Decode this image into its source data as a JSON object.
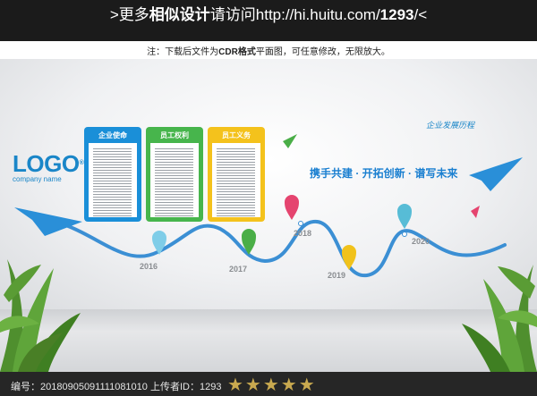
{
  "banner": {
    "prefix": ">更多",
    "highlight": "相似设计",
    "middle": "请访问http://hi.huitu.com/",
    "code": "1293",
    "suffix": "/<"
  },
  "note": {
    "before": "注：下载后文件为",
    "highlight": "CDR格式",
    "after": "平面图，可任意修改，无限放大。"
  },
  "logo": {
    "main": "LOGO",
    "mark": "®",
    "sub": "company name"
  },
  "panels": [
    {
      "title": "企业使命",
      "color": "#1a8fd8"
    },
    {
      "title": "员工权利",
      "color": "#47b54c"
    },
    {
      "title": "员工义务",
      "color": "#f4c21c"
    }
  ],
  "tagline": "携手共建 · 开拓创新 · 谱写未来",
  "history_title": "企业发展历程",
  "timeline": [
    {
      "year": "2016",
      "color": "#7fcde8"
    },
    {
      "year": "2017",
      "color": "#4aae47"
    },
    {
      "year": "2018",
      "color": "#e5446f"
    },
    {
      "year": "2019",
      "color": "#f1c21b"
    },
    {
      "year": "2020",
      "color": "#57bcd6"
    }
  ],
  "footer": {
    "text": "编号：20180905091111081010 上传者ID：1293",
    "stars": "★★★★★"
  },
  "colors": {
    "accent": "#1a86c8",
    "curve": "#3b8fd4",
    "dark_bar": "#1b1b1b"
  }
}
